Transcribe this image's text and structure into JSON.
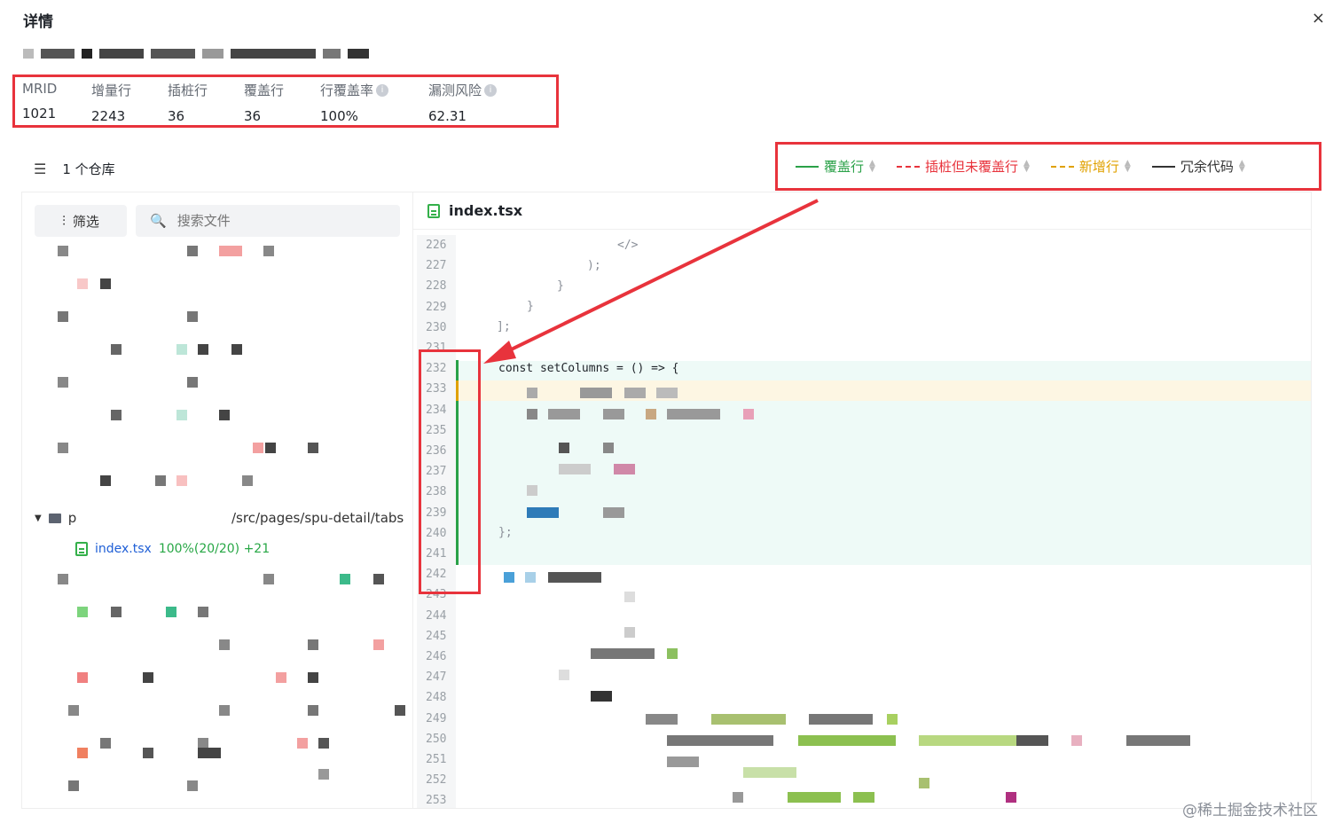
{
  "dialog": {
    "title": "详情",
    "close_label": "×"
  },
  "stats": [
    {
      "label": "MRID",
      "value": "1021",
      "info": false
    },
    {
      "label": "增量行",
      "value": "2243",
      "info": false
    },
    {
      "label": "插桩行",
      "value": "36",
      "info": false
    },
    {
      "label": "覆盖行",
      "value": "36",
      "info": false
    },
    {
      "label": "行覆盖率",
      "value": "100%",
      "info": true
    },
    {
      "label": "漏测风险",
      "value": "62.31",
      "info": true
    }
  ],
  "repo": {
    "label": "1 个仓库"
  },
  "legend": [
    {
      "label": "覆盖行",
      "color": "#2aa148",
      "style": "solid"
    },
    {
      "label": "插桩但未覆盖行",
      "color": "#e8333c",
      "style": "dash-dot"
    },
    {
      "label": "新增行",
      "color": "#e0a100",
      "style": "dashed"
    },
    {
      "label": "冗余代码",
      "color": "#333333",
      "style": "solid"
    }
  ],
  "sidebar": {
    "filter_label": "筛选",
    "search_placeholder": "搜索文件",
    "folder_prefix": "p",
    "folder_path": "/src/pages/spu-detail/tabs",
    "file": {
      "name": "index.tsx",
      "stats": "100%(20/20) +21"
    }
  },
  "editor": {
    "filename": "index.tsx",
    "line_numbers": [
      "226",
      "227",
      "228",
      "229",
      "230",
      "231",
      "232",
      "233",
      "234",
      "235",
      "236",
      "237",
      "238",
      "239",
      "240",
      "241",
      "242",
      "243",
      "244",
      "245",
      "246",
      "247",
      "248",
      "249",
      "250",
      "251",
      "252",
      "253"
    ],
    "code": {
      "l226": "</>",
      "l227": ");",
      "l228": "}",
      "l229": "}",
      "l230": "];",
      "l232": "const setColumns = () => {",
      "l240": "};"
    }
  },
  "watermark": "@稀土掘金技术社区"
}
